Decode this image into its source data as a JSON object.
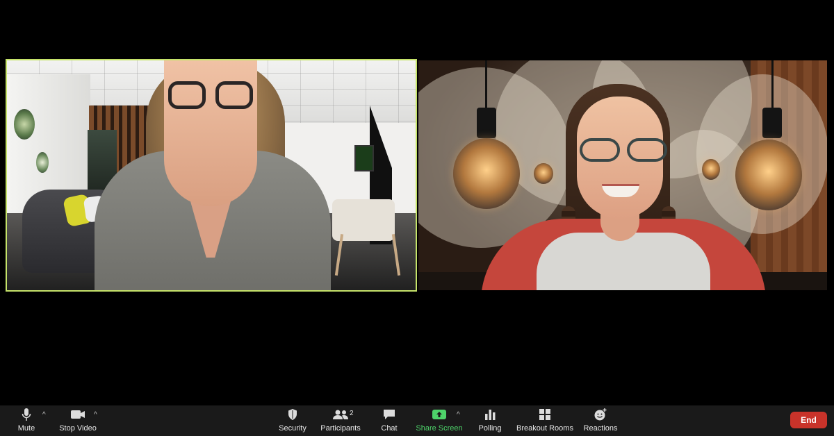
{
  "participants": [
    {
      "role": "active-speaker",
      "highlight_color": "#c6e36a"
    },
    {
      "role": "participant"
    }
  ],
  "toolbar": {
    "mute": {
      "label": "Mute",
      "icon": "microphone-icon"
    },
    "stop_video": {
      "label": "Stop Video",
      "icon": "video-camera-icon"
    },
    "security": {
      "label": "Security",
      "icon": "shield-icon"
    },
    "participants": {
      "label": "Participants",
      "count": "2",
      "icon": "people-icon"
    },
    "chat": {
      "label": "Chat",
      "icon": "chat-bubble-icon"
    },
    "share_screen": {
      "label": "Share Screen",
      "icon": "share-screen-icon",
      "color": "#4ed36a"
    },
    "polling": {
      "label": "Polling",
      "icon": "bar-chart-icon"
    },
    "breakout_rooms": {
      "label": "Breakout Rooms",
      "icon": "grid-icon"
    },
    "reactions": {
      "label": "Reactions",
      "icon": "smiley-add-icon"
    },
    "end": {
      "label": "End",
      "color": "#c9332a"
    }
  }
}
